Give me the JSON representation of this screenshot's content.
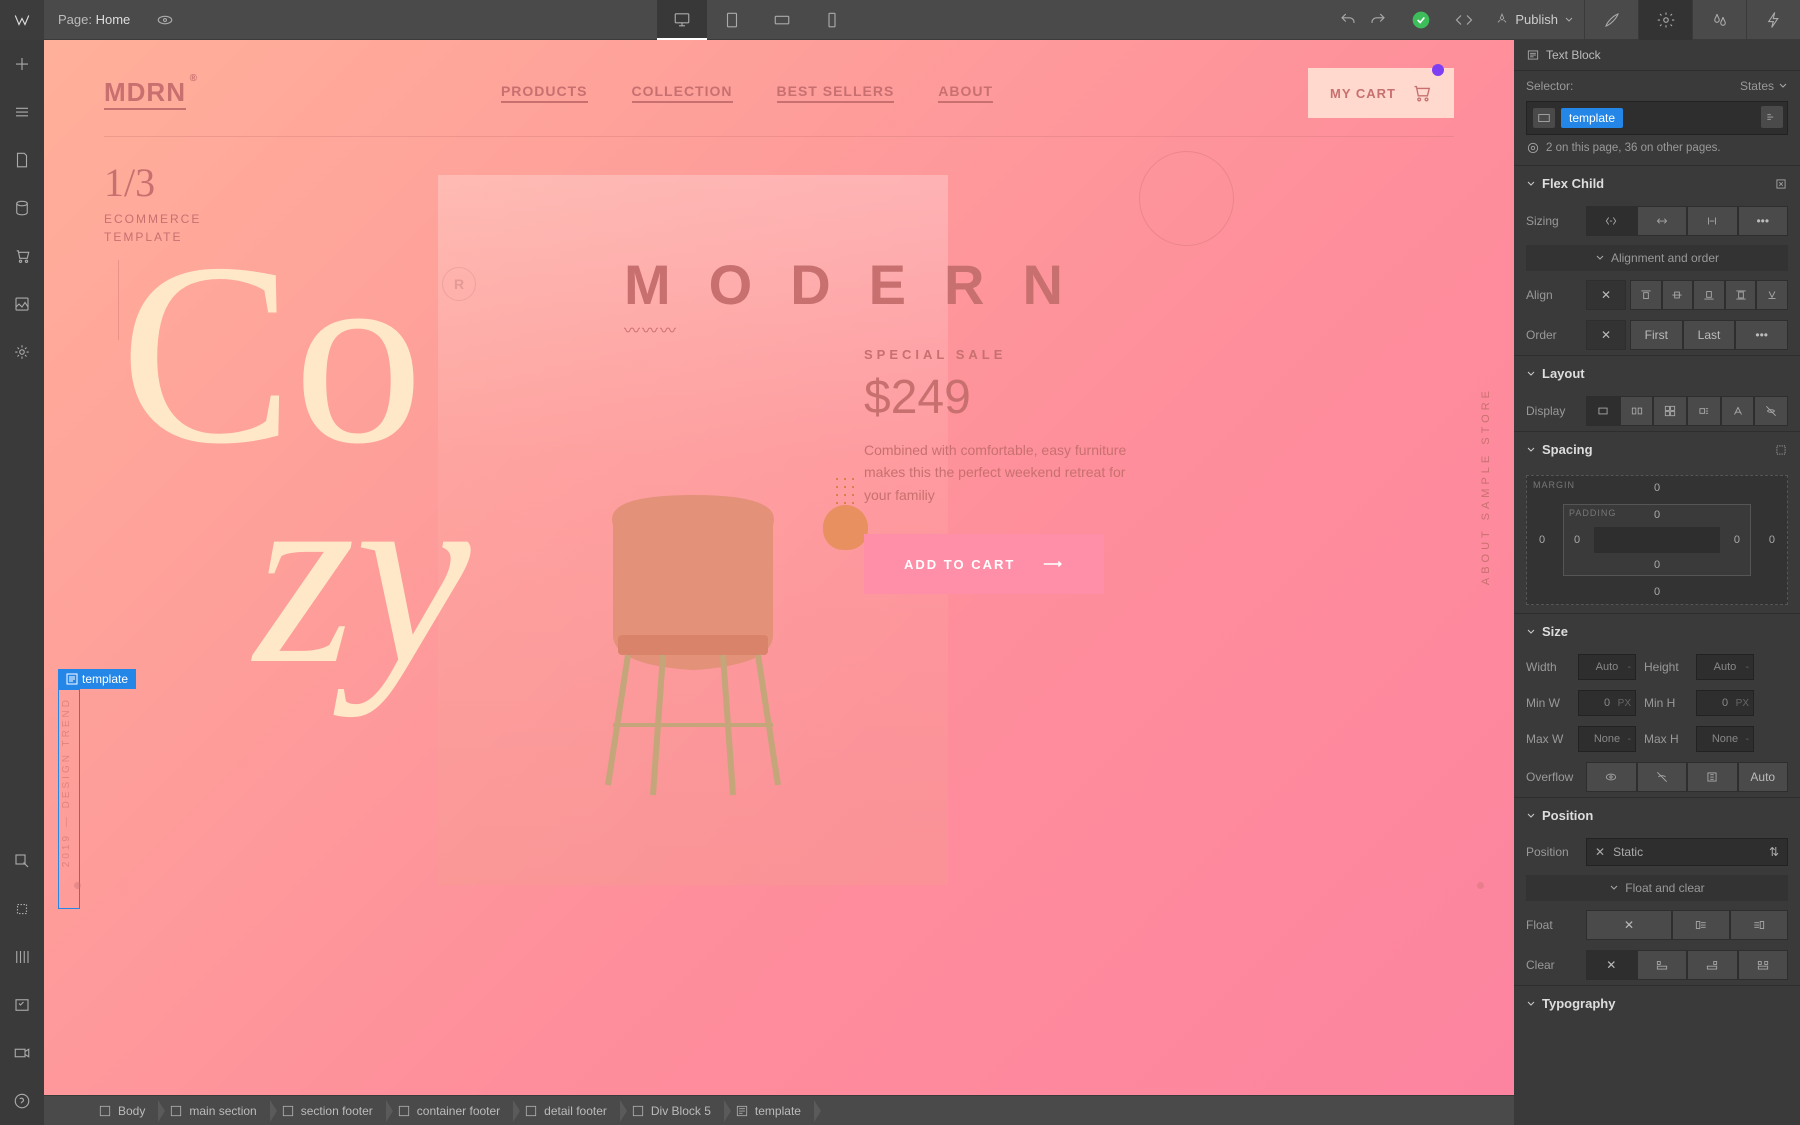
{
  "topbar": {
    "page_label": "Page:",
    "page_name": "Home",
    "publish_label": "Publish"
  },
  "right_panel": {
    "element_type": "Text Block",
    "selector_label": "Selector:",
    "states_label": "States",
    "selector_tag": "template",
    "usage": "2 on this page, 36 on other pages.",
    "sections": {
      "flex_child": "Flex Child",
      "layout": "Layout",
      "spacing": "Spacing",
      "size": "Size",
      "position": "Position",
      "typography": "Typography"
    },
    "flex": {
      "sizing_label": "Sizing",
      "align_label": "Align",
      "order_label": "Order",
      "alignment_order": "Alignment and order",
      "order_first": "First",
      "order_last": "Last"
    },
    "layout_row": {
      "display_label": "Display"
    },
    "spacing": {
      "margin_label": "MARGIN",
      "padding_label": "PADDING",
      "m_top": "0",
      "m_right": "0",
      "m_bottom": "0",
      "m_left": "0",
      "p_top": "0",
      "p_right": "0",
      "p_bottom": "0",
      "p_left": "0"
    },
    "size": {
      "width_label": "Width",
      "width_val": "Auto",
      "height_label": "Height",
      "height_val": "Auto",
      "minw_label": "Min W",
      "minw_val": "0",
      "minw_unit": "PX",
      "minh_label": "Min H",
      "minh_val": "0",
      "minh_unit": "PX",
      "maxw_label": "Max W",
      "maxw_val": "None",
      "maxh_label": "Max H",
      "maxh_val": "None",
      "overflow_label": "Overflow",
      "overflow_auto": "Auto"
    },
    "position": {
      "position_label": "Position",
      "position_val": "Static",
      "float_clear": "Float and clear",
      "float_label": "Float",
      "clear_label": "Clear"
    }
  },
  "canvas": {
    "brand": "MDRN",
    "nav": [
      "PRODUCTS",
      "COLLECTION",
      "BEST SELLERS",
      "ABOUT"
    ],
    "cart_label": "MY CART",
    "counter": "1/3",
    "counter_sub1": "ECOMMERCE",
    "counter_sub2": "TEMPLATE",
    "rbadge": "R",
    "hero_line1": "Co",
    "hero_line2": "zy",
    "modern": "MODERN",
    "zigzag": "〰〰〰",
    "sale_label": "SPECIAL SALE",
    "price": "$249",
    "sale_desc": "Combined with comfortable, easy furniture makes this the perfect weekend retreat for your familiy",
    "add_cart": "ADD TO CART",
    "vert_text": "ABOUT SAMPLE STORE",
    "vert_trend": "2019 — DESIGN TREND",
    "template_label": "template"
  },
  "breadcrumb": [
    "Body",
    "main section",
    "section footer",
    "container footer",
    "detail footer",
    "Div Block 5",
    "template"
  ]
}
